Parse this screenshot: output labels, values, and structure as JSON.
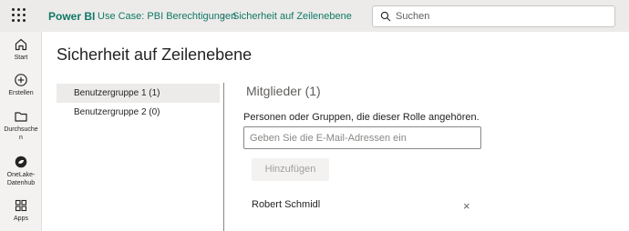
{
  "topbar": {
    "app_name": "Power BI",
    "breadcrumb": [
      "Use Case: PBI Berechtigungen",
      "Sicherheit auf Zeilenebene"
    ],
    "separator": "›",
    "search_placeholder": "Suchen"
  },
  "leftnav": {
    "items": [
      {
        "label": "Start",
        "icon": "home-icon"
      },
      {
        "label": "Erstellen",
        "icon": "plus-circle-icon"
      },
      {
        "label_lines": [
          "Durchsuche",
          "n"
        ],
        "icon": "folder-icon"
      },
      {
        "label_lines": [
          "OneLake-",
          "Datenhub"
        ],
        "icon": "onelake-icon"
      },
      {
        "label": "Apps",
        "icon": "apps-icon"
      }
    ]
  },
  "page": {
    "title": "Sicherheit auf Zeilenebene",
    "roles": [
      "Benutzergruppe 1 (1)",
      "Benutzergruppe 2 (0)"
    ],
    "selected_role": "Benutzergruppe 1 (1)",
    "members_title": "Mitglieder (1)",
    "description": "Personen oder Gruppen, die dieser Rolle angehören.",
    "email_placeholder": "Geben Sie die E-Mail-Adressen ein",
    "add_button": "Hinzufügen",
    "members": [
      {
        "name": "Robert Schmidl",
        "remove": "×"
      }
    ]
  },
  "colors": {
    "brand": "#117865",
    "topbar": "#ecebea",
    "selected_role": "#edebe9"
  }
}
